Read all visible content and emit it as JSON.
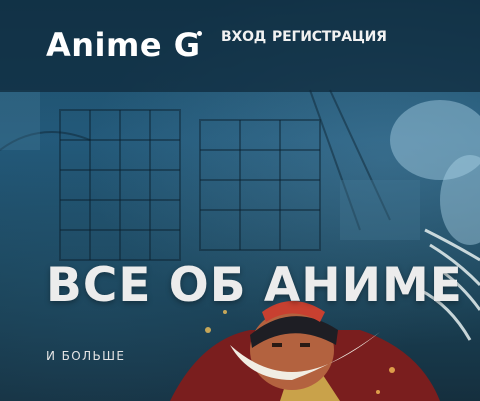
{
  "header": {
    "logo": "Anime G",
    "nav": {
      "login": "ВХОД",
      "register": "РЕГИСТРАЦИЯ"
    }
  },
  "hero": {
    "title": "ВСЕ ОБ АНИМЕ",
    "subtitle": "И БОЛЬШЕ"
  },
  "colors": {
    "overlay": "#0e283a",
    "background": "#22597a",
    "text": "#ffffff"
  }
}
